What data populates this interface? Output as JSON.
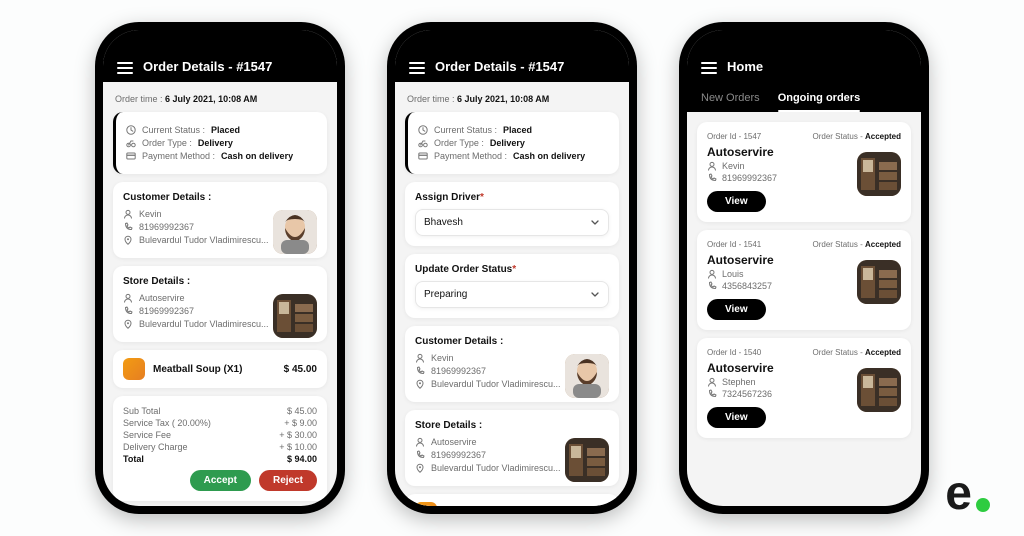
{
  "header": {
    "orderDetails": "Order Details - #1547",
    "home": "Home"
  },
  "orderTime": {
    "label": "Order time :",
    "value": "6 July 2021, 10:08 AM"
  },
  "status": {
    "currentLabel": "Current Status :",
    "currentValue": "Placed",
    "typeLabel": "Order Type :",
    "typeValue": "Delivery",
    "payLabel": "Payment Method :",
    "payValue": "Cash on delivery"
  },
  "customer": {
    "heading": "Customer Details :",
    "name": "Kevin",
    "phone": "81969992367",
    "address": "Bulevardul Tudor Vladimirescu..."
  },
  "store": {
    "heading": "Store Details :",
    "name": "Autoservire",
    "phone": "81969992367",
    "address": "Bulevardul Tudor Vladimirescu..."
  },
  "item": {
    "name": "Meatball Soup (X1)",
    "price": "$ 45.00"
  },
  "totals": {
    "rows": [
      {
        "label": "Sub Total",
        "value": "$ 45.00"
      },
      {
        "label": "Service Tax ( 20.00%)",
        "value": "+ $ 9.00"
      },
      {
        "label": "Service Fee",
        "value": "+ $ 30.00"
      },
      {
        "label": "Delivery Charge",
        "value": "+ $ 10.00"
      }
    ],
    "totalLabel": "Total",
    "totalValue": "$ 94.00"
  },
  "actions": {
    "accept": "Accept",
    "reject": "Reject"
  },
  "assign": {
    "driverHeading": "Assign Driver",
    "driverValue": "Bhavesh",
    "statusHeading": "Update Order Status",
    "statusValue": "Preparing",
    "req": "*"
  },
  "tabs": {
    "new": "New Orders",
    "ongoing": "Ongoing orders"
  },
  "orders": [
    {
      "id": "Order Id - 1547",
      "statusLabel": "Order Status -",
      "status": "Accepted",
      "store": "Autoservire",
      "name": "Kevin",
      "phone": "81969992367",
      "view": "View"
    },
    {
      "id": "Order Id - 1541",
      "statusLabel": "Order Status -",
      "status": "Accepted",
      "store": "Autoservire",
      "name": "Louis",
      "phone": "4356843257",
      "view": "View"
    },
    {
      "id": "Order Id - 1540",
      "statusLabel": "Order Status -",
      "status": "Accepted",
      "store": "Autoservire",
      "name": "Stephen",
      "phone": "7324567236",
      "view": "View"
    }
  ],
  "brand": {
    "letter": "e",
    "punct": "."
  }
}
